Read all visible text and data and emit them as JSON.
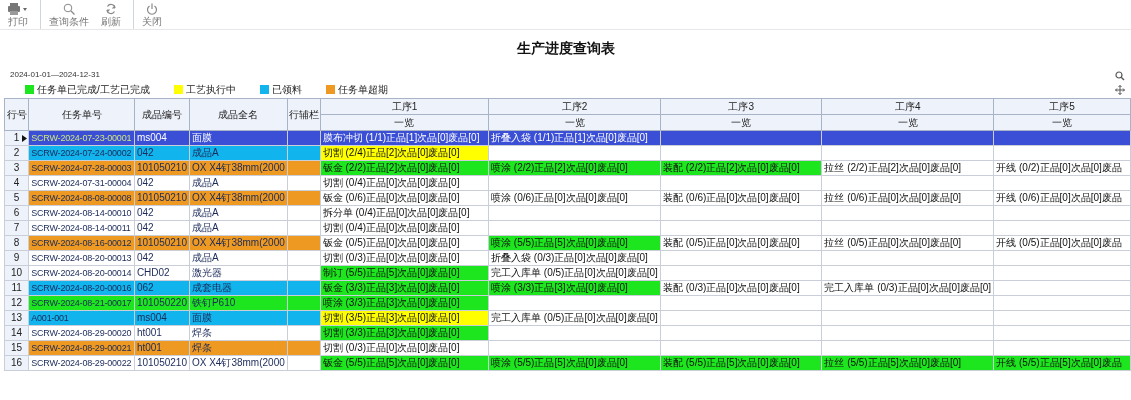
{
  "toolbar": [
    {
      "kind": "print",
      "label": "打印"
    },
    {
      "kind": "search",
      "label": "查询条件"
    },
    {
      "kind": "refresh",
      "label": "刷新"
    },
    {
      "kind": "power",
      "label": "关闭"
    }
  ],
  "title": "生产进度查询表",
  "date_range": "2024-01-01—2024-12-31",
  "legend": [
    {
      "color": "#1ee61e",
      "label": "任务单已完成/工艺已完成"
    },
    {
      "color": "#ffff00",
      "label": "工艺执行中"
    },
    {
      "color": "#11b4ec",
      "label": "已领料"
    },
    {
      "color": "#ee9a22",
      "label": "任务单超期"
    }
  ],
  "table": {
    "columns": [
      "行号",
      "任务单号",
      "成品编号",
      "成品全名",
      "行辅栏"
    ],
    "process_columns": [
      {
        "name": "工序1",
        "sub": "一览"
      },
      {
        "name": "工序2",
        "sub": "一览"
      },
      {
        "name": "工序3",
        "sub": "一览"
      },
      {
        "name": "工序4",
        "sub": "一览"
      },
      {
        "name": "工序5",
        "sub": "一览"
      }
    ],
    "rows": [
      {
        "no": "1",
        "task": "SCRW-2024-07-23-00001",
        "code": "ms004",
        "name": "面膜",
        "selected": true,
        "processes": [
          {
            "text": "膜布冲切 (1/1)正品[1]次品[0]废品[0]"
          },
          {
            "text": "折叠入袋 (1/1)正品[1]次品[0]废品[0]"
          }
        ]
      },
      {
        "no": "2",
        "task": "SCRW-2024-07-24-00002",
        "code": "042",
        "name": "成品A",
        "color": "#11b4ec",
        "selected": false,
        "processes": [
          {
            "text": "切割 (2/4)正品[2]次品[0]废品[0]",
            "color": "#ffff00"
          }
        ]
      },
      {
        "no": "3",
        "task": "SCRW-2024-07-28-00003",
        "code": "101050210",
        "name": "OX X4钉38mm(2000",
        "color": "#ee9a22",
        "selected": false,
        "processes": [
          {
            "text": "钣金 (2/2)正品[2]次品[0]废品[0]",
            "color": "#1ee61e"
          },
          {
            "text": "喷涂 (2/2)正品[2]次品[0]废品[0]",
            "color": "#1ee61e"
          },
          {
            "text": "装配 (2/2)正品[2]次品[0]废品[0]",
            "color": "#1ee61e"
          },
          {
            "text": "拉丝 (2/2)正品[2]次品[0]废品[0]"
          },
          {
            "text": "开线 (0/2)正品[0]次品[0]废品"
          }
        ]
      },
      {
        "no": "4",
        "task": "SCRW-2024-07-31-00004",
        "code": "042",
        "name": "成品A",
        "selected": false,
        "processes": [
          {
            "text": "切割 (0/4)正品[0]次品[0]废品[0]"
          }
        ]
      },
      {
        "no": "5",
        "task": "SCRW-2024-08-08-00008",
        "code": "101050210",
        "name": "OX X4钉38mm(2000",
        "color": "#ee9a22",
        "selected": false,
        "processes": [
          {
            "text": "钣金 (0/6)正品[0]次品[0]废品[0]"
          },
          {
            "text": "喷涂 (0/6)正品[0]次品[0]废品[0]"
          },
          {
            "text": "装配 (0/6)正品[0]次品[0]废品[0]"
          },
          {
            "text": "拉丝 (0/6)正品[0]次品[0]废品[0]"
          },
          {
            "text": "开线 (0/6)正品[0]次品[0]废品"
          }
        ]
      },
      {
        "no": "6",
        "task": "SCRW-2024-08-14-00010",
        "code": "042",
        "name": "成品A",
        "selected": false,
        "processes": [
          {
            "text": "拆分单 (0/4)正品[0]次品[0]废品[0]"
          }
        ]
      },
      {
        "no": "7",
        "task": "SCRW-2024-08-14-00011",
        "code": "042",
        "name": "成品A",
        "selected": false,
        "processes": [
          {
            "text": "切割 (0/4)正品[0]次品[0]废品[0]"
          }
        ]
      },
      {
        "no": "8",
        "task": "SCRW-2024-08-16-00012",
        "code": "101050210",
        "name": "OX X4钉38mm(2000",
        "color": "#ee9a22",
        "selected": false,
        "processes": [
          {
            "text": "钣金 (0/5)正品[0]次品[0]废品[0]"
          },
          {
            "text": "喷涂 (5/5)正品[5]次品[0]废品[0]",
            "color": "#1ee61e"
          },
          {
            "text": "装配 (0/5)正品[0]次品[0]废品[0]"
          },
          {
            "text": "拉丝 (0/5)正品[0]次品[0]废品[0]"
          },
          {
            "text": "开线 (0/5)正品[0]次品[0]废品"
          }
        ]
      },
      {
        "no": "9",
        "task": "SCRW-2024-08-20-00013",
        "code": "042",
        "name": "成品A",
        "selected": false,
        "processes": [
          {
            "text": "切割 (0/3)正品[0]次品[0]废品[0]"
          },
          {
            "text": "折叠入袋 (0/3)正品[0]次品[0]废品[0]"
          }
        ]
      },
      {
        "no": "10",
        "task": "SCRW-2024-08-20-00014",
        "code": "CHD02",
        "name": "激光器",
        "selected": false,
        "processes": [
          {
            "text": "制订 (5/5)正品[5]次品[0]废品[0]",
            "color": "#1ee61e"
          },
          {
            "text": "完工入库单 (0/5)正品[0]次品[0]废品[0]"
          }
        ]
      },
      {
        "no": "11",
        "task": "SCRW-2024-08-20-00016",
        "code": "062",
        "name": "成套电器",
        "color": "#11b4ec",
        "selected": false,
        "processes": [
          {
            "text": "钣金 (3/3)正品[3]次品[0]废品[0]",
            "color": "#1ee61e"
          },
          {
            "text": "喷涂 (3/3)正品[3]次品[0]废品[0]",
            "color": "#1ee61e"
          },
          {
            "text": "装配 (0/3)正品[0]次品[0]废品[0]"
          },
          {
            "text": "完工入库单 (0/3)正品[0]次品[0]废品[0]"
          }
        ]
      },
      {
        "no": "12",
        "task": "SCRW-2024-08-21-00017",
        "code": "101050220",
        "name": "铁钉P610",
        "color": "#1ee61e",
        "selected": false,
        "processes": [
          {
            "text": "喷涂 (3/3)正品[3]次品[0]废品[0]",
            "color": "#1ee61e"
          }
        ]
      },
      {
        "no": "13",
        "task": "A001-001",
        "code": "ms004",
        "name": "面膜",
        "color": "#11b4ec",
        "selected": false,
        "processes": [
          {
            "text": "切割 (3/5)正品[3]次品[0]废品[0]",
            "color": "#ffff00"
          },
          {
            "text": "完工入库单 (0/5)正品[0]次品[0]废品[0]"
          }
        ]
      },
      {
        "no": "14",
        "task": "SCRW-2024-08-29-00020",
        "code": "ht001",
        "name": "焊条",
        "selected": false,
        "processes": [
          {
            "text": "切割 (3/3)正品[3]次品[0]废品[0]",
            "color": "#1ee61e"
          }
        ]
      },
      {
        "no": "15",
        "task": "SCRW-2024-08-29-00021",
        "code": "ht001",
        "name": "焊条",
        "color": "#ee9a22",
        "selected": false,
        "processes": [
          {
            "text": "切割 (0/3)正品[0]次品[0]废品[0]"
          }
        ]
      },
      {
        "no": "16",
        "task": "SCRW-2024-08-29-00022",
        "code": "101050210",
        "name": "OX X4钉38mm(2000",
        "selected": false,
        "processes": [
          {
            "text": "钣金 (5/5)正品[5]次品[0]废品[0]",
            "color": "#1ee61e"
          },
          {
            "text": "喷涂 (5/5)正品[5]次品[0]废品[0]",
            "color": "#1ee61e"
          },
          {
            "text": "装配 (5/5)正品[5]次品[0]废品[0]",
            "color": "#1ee61e"
          },
          {
            "text": "拉丝 (5/5)正品[5]次品[0]废品[0]",
            "color": "#1ee61e"
          },
          {
            "text": "开线 (5/5)正品[5]次品[0]废品",
            "color": "#1ee61e"
          }
        ]
      }
    ]
  }
}
